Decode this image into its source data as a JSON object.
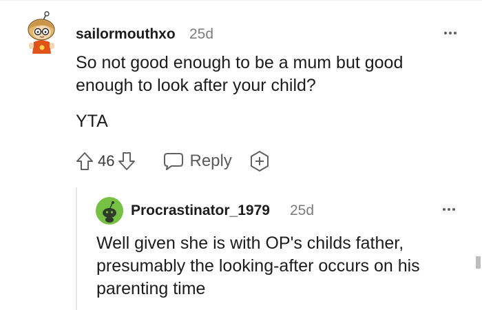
{
  "comments": [
    {
      "username": "sailormouthxo",
      "age": "25d",
      "paragraphs": [
        "So not good enough to be a mum but good enough to look after your child?",
        "YTA"
      ],
      "vote_count": "46",
      "reply_label": "Reply",
      "avatar_icon": "cartoon-avatar-icon"
    },
    {
      "username": "Procrastinator_1979",
      "age": "25d",
      "text": "Well given she is with OP's childs father, presumably the looking-after occurs on his parenting time",
      "avatar_icon": "snoo-avatar-icon",
      "avatar_color": "#76c043"
    }
  ],
  "colors": {
    "text": "#1c1c1c",
    "meta": "#7c7c7c",
    "icon": "#606060",
    "thread_line": "#e3e5e8"
  }
}
